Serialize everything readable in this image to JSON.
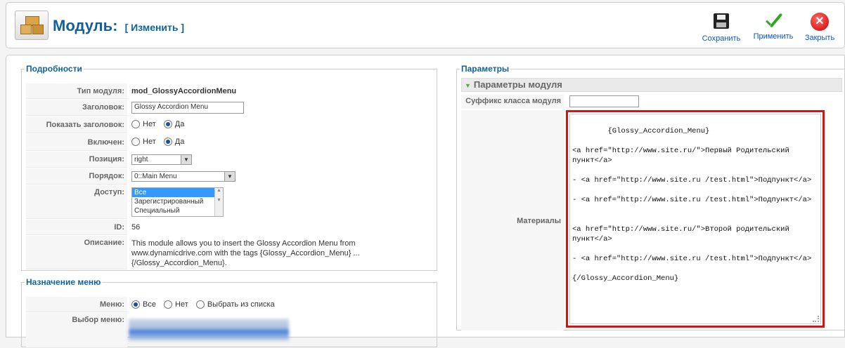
{
  "toolbar": {
    "title": "Модуль:",
    "title_sub": "[ Изменить ]",
    "save_label": "Сохранить",
    "apply_label": "Применить",
    "close_label": "Закрыть"
  },
  "details": {
    "legend": "Подробности",
    "module_type_label": "Тип модуля:",
    "module_type_value": "mod_GlossyAccordionMenu",
    "title_label": "Заголовок:",
    "title_value": "Glossy Accordion Menu",
    "show_title_label": "Показать заголовок:",
    "enabled_label": "Включен:",
    "no_label": "Нет",
    "yes_label": "Да",
    "position_label": "Позиция:",
    "position_value": "right",
    "order_label": "Порядок:",
    "order_value": "0::Main Menu",
    "access_label": "Доступ:",
    "access_options": [
      "Все",
      "Зарегистрированный",
      "Специальный"
    ],
    "id_label": "ID:",
    "id_value": "56",
    "description_label": "Описание:",
    "description_value": "This module allows you to insert the Glossy Accordion Menu from www.dynamicdrive.com with the tags {Glossy_Accordion_Menu} ... {/Glossy_Accordion_Menu}."
  },
  "menu_assignment": {
    "legend": "Назначение меню",
    "menu_label": "Меню:",
    "all_label": "Все",
    "none_label": "Нет",
    "select_label": "Выбрать из списка",
    "menu_select_label": "Выбор меню:"
  },
  "params": {
    "legend": "Параметры",
    "header": "Параметры модуля",
    "suffix_label": "Суффикс класса модуля",
    "suffix_value": "",
    "materials_label": "Материалы",
    "materials_text": "{Glossy_Accordion_Menu}\n\n<a href=\"http://www.site.ru/\">Первый Родительский пункт</a>\n\n- <a href=\"http://www.site.ru /test.html\">Подпункт</a>\n\n- <a href=\"http://www.site.ru /test.html\">Подпункт</a>\n\n\n<a href=\"http://www.site.ru/\">Второй родительский пункт</a>\n\n- <a href=\"http://www.site.ru /test.html\">Подпункт</a>\n\n{/Glossy_Accordion_Menu}"
  },
  "colors": {
    "title_blue": "#146295",
    "highlight_red": "#d01515",
    "link_blue": "#0b55c4"
  }
}
